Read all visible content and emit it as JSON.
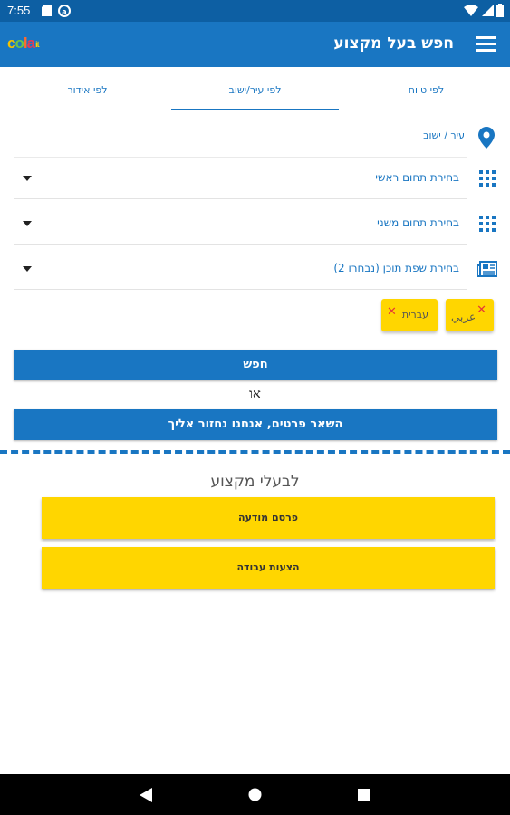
{
  "status_bar": {
    "time": "7:55"
  },
  "app_bar": {
    "logo": {
      "part1": "c",
      "part2": "o",
      "part3": "l",
      "part4": "a",
      "suffix": "it"
    },
    "title": "חפש בעל מקצוע"
  },
  "tabs": [
    {
      "label": "לפי טווח"
    },
    {
      "label": "לפי עיר/ישוב",
      "active": true
    },
    {
      "label": "לפי אידור"
    }
  ],
  "form": {
    "city_placeholder": "עיר / ישוב",
    "main_field": "בחירת תחום ראשי",
    "secondary_field": "בחירת תחום משני",
    "language_field": "בחירת שפת תוכן (נבחרו 2)"
  },
  "chips": [
    {
      "label": "עברית"
    },
    {
      "label": "عربي"
    }
  ],
  "buttons": {
    "search": "חפש",
    "or_text": "או",
    "leave_details": "השאר פרטים, אנחנו נחזור אליך"
  },
  "professionals": {
    "title": "לבעלי מקצוע",
    "publish_ad": "פרסם מודעה",
    "job_offers": "הצעות עבודה"
  },
  "colors": {
    "primary": "#1976c2",
    "status_bar": "#0d5fa3",
    "accent_yellow": "#ffd600",
    "chip_close": "#e53935"
  }
}
